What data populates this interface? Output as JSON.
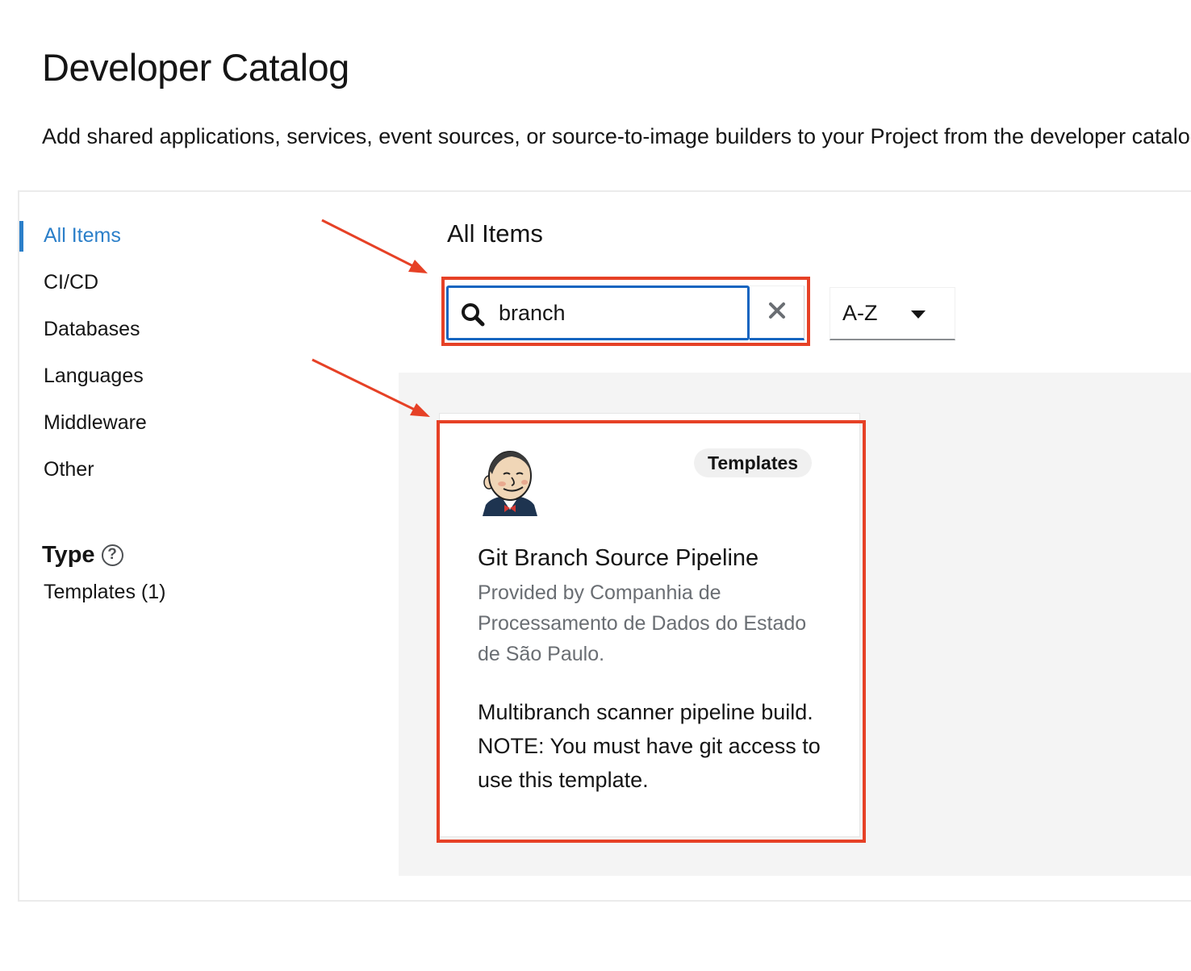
{
  "page": {
    "title": "Developer Catalog",
    "description": "Add shared applications, services, event sources, or source-to-image builders to your Project from the developer catalog."
  },
  "sidebar": {
    "items": [
      {
        "label": "All Items",
        "active": true
      },
      {
        "label": "CI/CD",
        "active": false
      },
      {
        "label": "Databases",
        "active": false
      },
      {
        "label": "Languages",
        "active": false
      },
      {
        "label": "Middleware",
        "active": false
      },
      {
        "label": "Other",
        "active": false
      }
    ],
    "type_heading": "Type",
    "type_filters": [
      {
        "label": "Templates (1)"
      }
    ]
  },
  "main": {
    "title": "All Items",
    "search": {
      "value": "branch"
    },
    "sort": {
      "value": "A-Z"
    }
  },
  "card": {
    "badge": "Templates",
    "logo_icon": "jenkins-logo-icon",
    "title": "Git Branch Source Pipeline",
    "provider": "Provided by Companhia de Processamento de Dados do Estado de São Paulo.",
    "description": "Multibranch scanner pipeline build. NOTE: You must have git access to use this template."
  },
  "colors": {
    "active_link": "#2b7fc9",
    "search_focus": "#1565c0",
    "annotation": "#e64126",
    "tile_background": "#f4f4f4"
  }
}
